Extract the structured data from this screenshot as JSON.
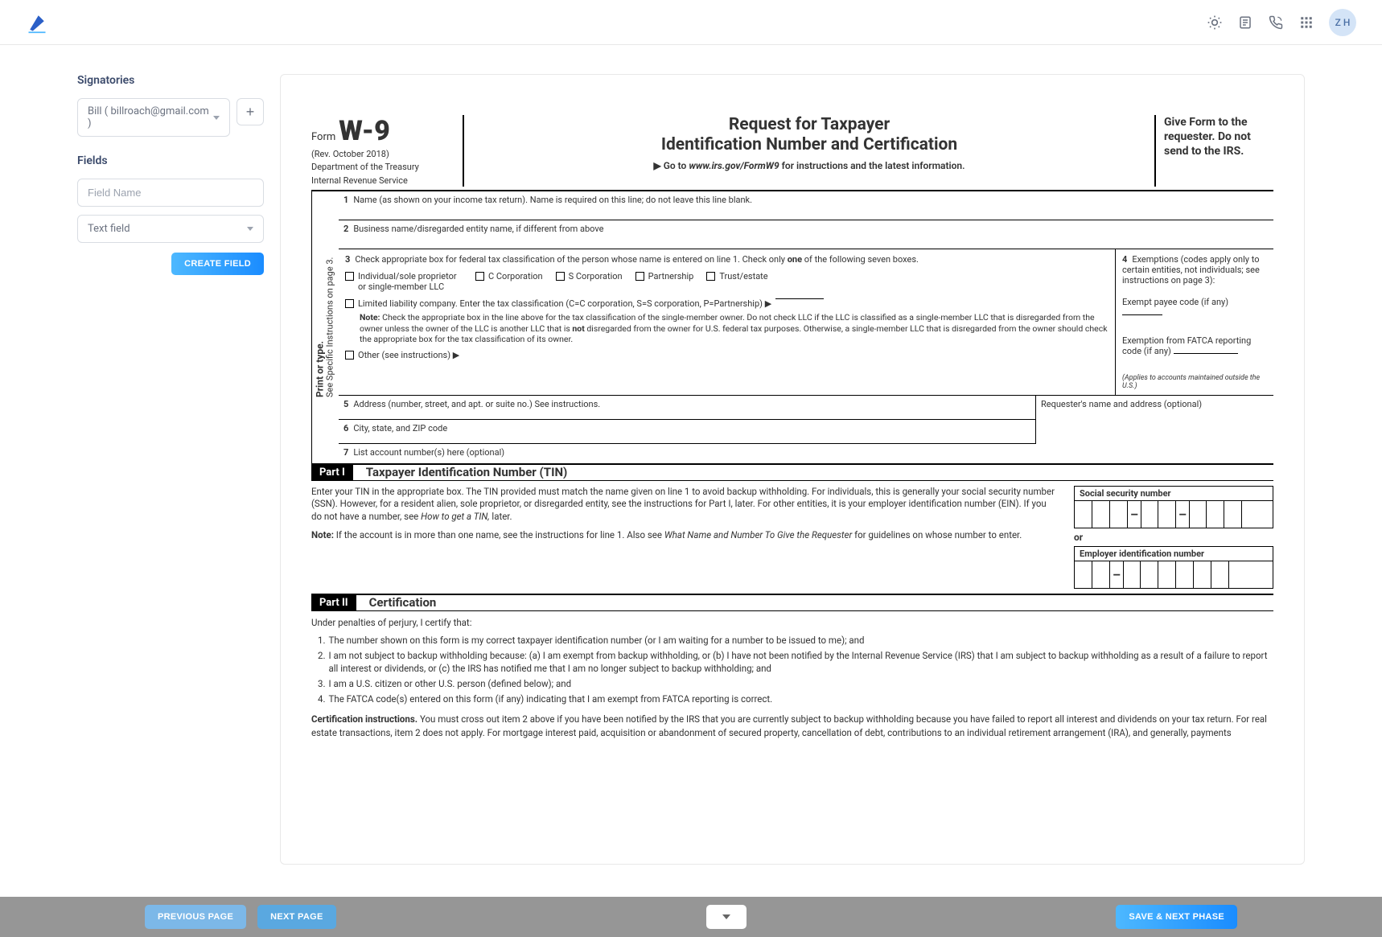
{
  "header": {
    "avatar_initials": "Z H"
  },
  "sidebar": {
    "signatories_title": "Signatories",
    "signatory_selected": "Bill ( billroach@gmail.com )",
    "fields_title": "Fields",
    "field_name_placeholder": "Field Name",
    "field_type_selected": "Text field",
    "create_field_label": "CREATE FIELD"
  },
  "form": {
    "form_word": "Form",
    "form_code": "W-9",
    "rev": "(Rev. October 2018)",
    "dept": "Department of the Treasury",
    "irs": "Internal Revenue Service",
    "title_line1": "Request for Taxpayer",
    "title_line2": "Identification Number and Certification",
    "goto_prefix": "▶ Go to ",
    "goto_url": "www.irs.gov/FormW9",
    "goto_suffix": " for instructions and the latest information.",
    "give_form": "Give Form to the requester. Do not send to the IRS.",
    "vertical_main": "Print or type.",
    "vertical_sub": "See Specific Instructions on page 3.",
    "row1_num": "1",
    "row1": "Name (as shown on your income tax return). Name is required on this line; do not leave this line blank.",
    "row2_num": "2",
    "row2": "Business name/disregarded entity name, if different from above",
    "row3_num": "3",
    "row3_prefix": "Check appropriate box for federal tax classification of the person whose name is entered on line 1. Check only ",
    "row3_bold": "one",
    "row3_suffix": " of the following seven boxes.",
    "cb1": "Individual/sole proprietor or single-member LLC",
    "cb2": "C Corporation",
    "cb3": "S Corporation",
    "cb4": "Partnership",
    "cb5": "Trust/estate",
    "llc_line": "Limited liability company. Enter the tax classification (C=C corporation, S=S corporation, P=Partnership) ▶",
    "note_label": "Note:",
    "note_text_a": " Check the appropriate box in the line above for the tax classification of the single-member owner.  Do not check LLC if the LLC is classified as a single-member LLC that is disregarded from the owner unless the owner of the LLC is another LLC that is ",
    "note_bold": "not",
    "note_text_b": " disregarded from the owner for U.S. federal tax purposes. Otherwise, a single-member LLC that is disregarded from the owner should check the appropriate box for the tax classification of its owner.",
    "other_line": "Other (see instructions) ▶",
    "row4_num": "4",
    "row4_text": "Exemptions (codes apply only to certain entities, not individuals; see instructions on page 3):",
    "exempt_payee": "Exempt payee code (if any)",
    "exempt_fatca": "Exemption from FATCA reporting code (if any)",
    "fatca_note": "(Applies to accounts maintained outside the U.S.)",
    "row5_num": "5",
    "row5": "Address (number, street, and apt. or suite no.) See instructions.",
    "requester_addr": "Requester's name and address (optional)",
    "row6_num": "6",
    "row6": "City, state, and ZIP code",
    "row7_num": "7",
    "row7": "List account number(s) here (optional)",
    "part1_badge": "Part I",
    "part1_title": "Taxpayer Identification Number (TIN)",
    "tin_text_a": "Enter your TIN in the appropriate box. The TIN provided must match the name given on line 1 to avoid backup withholding. For individuals, this is generally your social security number (SSN). However, for a resident alien, sole proprietor, or disregarded entity, see the instructions for Part I, later. For other entities, it is your employer identification number (EIN). If you do not have a number, see ",
    "tin_italic_a": "How to get a TIN,",
    "tin_text_b": " later.",
    "tin_note_label": "Note:",
    "tin_note_text": " If the account is in more than one name, see the instructions for line 1. Also see ",
    "tin_note_italic": "What Name and Number To Give the Requester",
    "tin_note_suffix": " for guidelines on whose number to enter.",
    "ssn_label": "Social security number",
    "or_label": "or",
    "ein_label": "Employer identification number",
    "part2_badge": "Part II",
    "part2_title": "Certification",
    "cert_intro": "Under penalties of perjury, I certify that:",
    "cert1": "The number shown on this form is my correct taxpayer identification number (or I am waiting for a number to be issued to me); and",
    "cert2": "I am not subject to backup withholding because: (a) I am exempt from backup withholding, or (b) I have not been notified by the Internal Revenue Service (IRS) that I am subject to backup withholding as a result of a failure to report all interest or dividends, or (c) the IRS has notified me that I am no longer subject to backup withholding; and",
    "cert3": "I am a U.S. citizen or other U.S. person (defined below); and",
    "cert4": "The FATCA code(s) entered on this form (if any) indicating that I am exempt from FATCA reporting is correct.",
    "cert_instr_label": "Certification instructions.",
    "cert_instr_text": " You must cross out item 2 above if you have been notified by the IRS that you are currently subject to backup withholding because you have failed to report all interest and dividends on your tax return. For real estate transactions, item 2 does not apply. For mortgage interest paid, acquisition or abandonment of secured property, cancellation of debt, contributions to an individual retirement arrangement (IRA), and generally, payments"
  },
  "footer": {
    "prev_label": "PREVIOUS PAGE",
    "next_label": "NEXT PAGE",
    "save_label": "SAVE & NEXT PHASE"
  }
}
